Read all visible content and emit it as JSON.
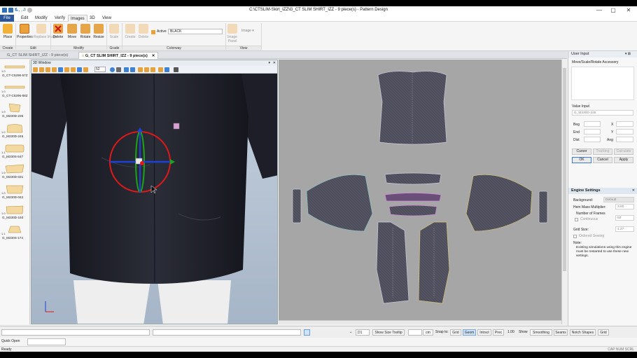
{
  "window": {
    "title": "C:\\CTSLIM-Skirt_IZZ\\G_CT SLIM SHIRT_IZZ - 9 piece(s) - Pattern Design",
    "minimize": "—",
    "maximize": "▢",
    "close": "✕"
  },
  "menu": {
    "tabs": [
      "File",
      "Edit",
      "Modify",
      "Verify",
      "Images",
      "3D",
      "View"
    ],
    "active": "Images"
  },
  "ribbon": {
    "buttons": {
      "place": "Place",
      "properties": "Properties",
      "replace": "Replace Image",
      "delete": "Delete",
      "move": "Move",
      "rotate": "Rotate",
      "resize": "Resize",
      "scale": "Scale",
      "create": "Create",
      "delete2": "Delete",
      "image_panel": "Image Panel"
    },
    "active_label": "Active",
    "active_value": "BLACK",
    "image_dropdown": "Image ▾",
    "groups": [
      "Create",
      "Edit",
      "Modify",
      "Grade",
      "Colorway",
      "View"
    ]
  },
  "doc_tabs": [
    {
      "label": "G_CT SLIM SHIRT_IZZ - 9 piece(s)",
      "active": false
    },
    {
      "label": "G_CT SLIM SHIRT_IZZ - 9 piece(s)",
      "active": true
    }
  ],
  "pieces": [
    {
      "num": "1.0",
      "name": "G_CT-C5296-57Z"
    },
    {
      "num": "1.0",
      "name": "G_CT-C5296-58Z"
    },
    {
      "num": "1.0",
      "name": "G_M230D-236"
    },
    {
      "num": "1.0",
      "name": "G_M230D-245"
    },
    {
      "num": "1.1",
      "name": "G_M230S-547"
    },
    {
      "num": "1.0",
      "name": "G_M230D-031"
    },
    {
      "num": "1.0",
      "name": "G_M230D-042"
    },
    {
      "num": "1.0",
      "name": "G_M230D-193"
    },
    {
      "num": "1.1",
      "name": "G_M230S-174"
    }
  ],
  "window3d": {
    "title": "3D Window",
    "zoom": "52"
  },
  "right_panel": {
    "user_input": {
      "title": "User Input",
      "command": "Move/Scale/Rotate Accessory",
      "value_input_label": "Value Input",
      "value_input": "G_M230D-245",
      "beg": "Beg",
      "end": "End",
      "dist": "Dist",
      "x": "X",
      "y": "Y",
      "ang": "Ang",
      "buttons": [
        "Cursor",
        "Tracking",
        "Calculate"
      ],
      "ok": "OK",
      "cancel": "Cancel",
      "apply": "Apply"
    },
    "engine": {
      "title": "Engine Settings",
      "background_label": "Background:",
      "background_value": "Default",
      "hem_label": "Hem Mass Multiplier:",
      "hem_value": "3.00",
      "frames_label": "Number of Frames",
      "continuous": "Continuous",
      "frames_value": "50",
      "grid_label": "Grid Size:",
      "grid_value": "1.27",
      "ordered": "Ordered Sewing",
      "note_label": "Note:",
      "note": "Existing simulations using this engine must be restarted to use these new settings."
    }
  },
  "bottom": {
    "d1": "D1",
    "show_size_tooltip": "Show Size Tooltip",
    "unit": "cm",
    "snap_to": "Snap to:",
    "snaps": [
      "Grid",
      "Geom",
      "Intrsct",
      "Prec"
    ],
    "value": "1.00",
    "show": "Show",
    "shows": [
      "Smoothing",
      "Seams",
      "Notch Shapes",
      "Grid"
    ]
  },
  "quick_open": "Quick Open",
  "status": {
    "ready": "Ready",
    "right": "CAP  NUM  SCRL"
  },
  "colors": {
    "file_tab": "#2b579a",
    "shirt": "#232530",
    "pattern_fill": "#4e4e5c",
    "gizmo_red": "#e01818",
    "gizmo_green": "#19a519",
    "gizmo_blue": "#1c40d8"
  }
}
